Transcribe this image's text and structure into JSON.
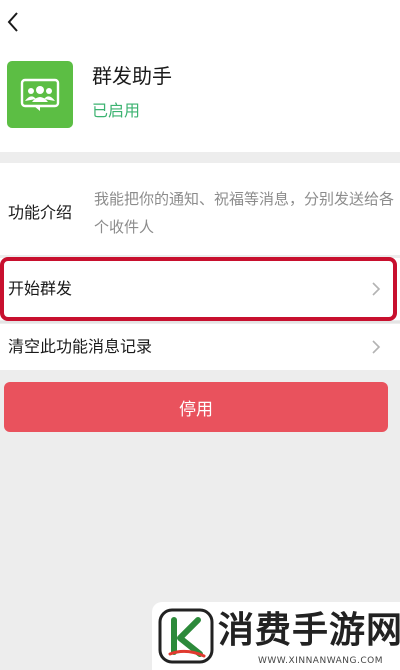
{
  "header": {
    "back_icon": "chevron-left-icon",
    "app_icon": "group-chat-icon",
    "app_title": "群发助手",
    "app_status": "已启用"
  },
  "intro": {
    "label": "功能介绍",
    "text": "我能把你的通知、祝福等消息，分别发送给各个收件人"
  },
  "rows": {
    "start": {
      "label": "开始群发",
      "icon": "chevron-right-icon"
    },
    "clear": {
      "label": "清空此功能消息记录",
      "icon": "chevron-right-icon"
    }
  },
  "disable_button": {
    "label": "停用"
  },
  "watermark": {
    "name": "消费手游网",
    "url": "WWW.XINNANWANG.COM"
  },
  "colors": {
    "app_icon_bg": "#5cbe44",
    "status_green": "#3cb371",
    "danger_red": "#e9525d",
    "highlight_red": "#c8102e",
    "background_gray": "#ededed"
  }
}
